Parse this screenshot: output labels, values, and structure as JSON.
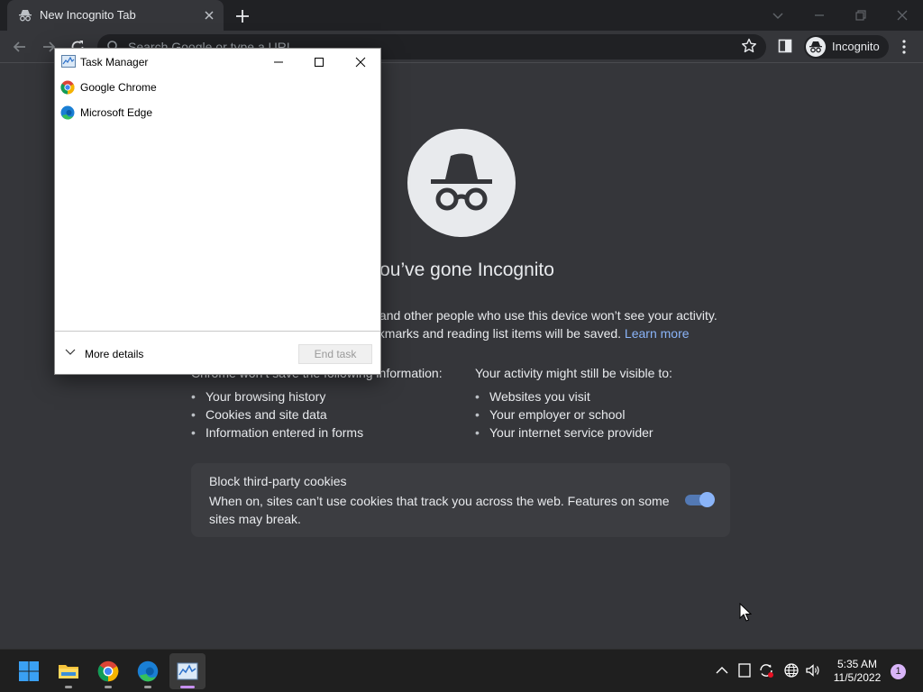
{
  "chrome": {
    "tab_title": "New Incognito Tab",
    "omnibox_placeholder": "Search Google or type a URL",
    "profile_label": "Incognito"
  },
  "ntp": {
    "heading": "You’ve gone Incognito",
    "para1": "Now you can browse privately, and other people who use this device won’t see your activity.",
    "para2": "However, downloads, bookmarks and reading list items will be saved.",
    "learn_more": "Learn more",
    "left_col": {
      "title": "Chrome won’t save the following information:",
      "items": [
        "Your browsing history",
        "Cookies and site data",
        "Information entered in forms"
      ]
    },
    "right_col": {
      "title": "Your activity might still be visible to:",
      "items": [
        "Websites you visit",
        "Your employer or school",
        "Your internet service provider"
      ]
    },
    "cookie_card": {
      "title": "Block third-party cookies",
      "description": "When on, sites can’t use cookies that track you across the web. Features on some sites may break.",
      "toggle_on": true
    }
  },
  "task_manager": {
    "title": "Task Manager",
    "apps": [
      "Google Chrome",
      "Microsoft Edge"
    ],
    "more_details": "More details",
    "end_task": "End task"
  },
  "taskbar": {
    "apps": [
      "start",
      "file-explorer",
      "google-chrome",
      "microsoft-edge",
      "task-manager"
    ],
    "time": "5:35 AM",
    "date": "11/5/2022",
    "notification_count": "1"
  },
  "colors": {
    "accent": "#8ab4f8",
    "chrome_bg": "#35363a",
    "taskbar_bg": "#1f1f1f"
  }
}
